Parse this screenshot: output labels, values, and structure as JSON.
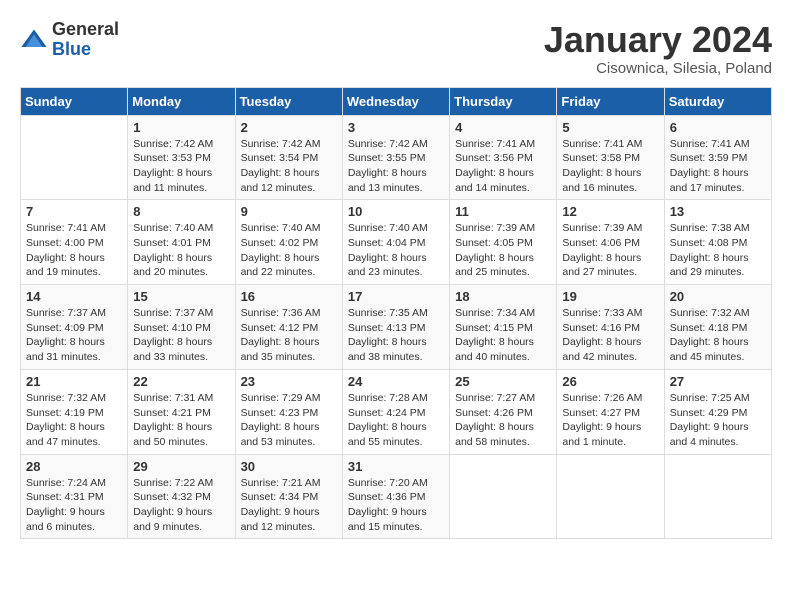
{
  "header": {
    "logo": {
      "general": "General",
      "blue": "Blue"
    },
    "title": "January 2024",
    "location": "Cisownica, Silesia, Poland"
  },
  "days_of_week": [
    "Sunday",
    "Monday",
    "Tuesday",
    "Wednesday",
    "Thursday",
    "Friday",
    "Saturday"
  ],
  "weeks": [
    [
      {
        "day": "",
        "sunrise": "",
        "sunset": "",
        "daylight": ""
      },
      {
        "day": "1",
        "sunrise": "Sunrise: 7:42 AM",
        "sunset": "Sunset: 3:53 PM",
        "daylight": "Daylight: 8 hours and 11 minutes."
      },
      {
        "day": "2",
        "sunrise": "Sunrise: 7:42 AM",
        "sunset": "Sunset: 3:54 PM",
        "daylight": "Daylight: 8 hours and 12 minutes."
      },
      {
        "day": "3",
        "sunrise": "Sunrise: 7:42 AM",
        "sunset": "Sunset: 3:55 PM",
        "daylight": "Daylight: 8 hours and 13 minutes."
      },
      {
        "day": "4",
        "sunrise": "Sunrise: 7:41 AM",
        "sunset": "Sunset: 3:56 PM",
        "daylight": "Daylight: 8 hours and 14 minutes."
      },
      {
        "day": "5",
        "sunrise": "Sunrise: 7:41 AM",
        "sunset": "Sunset: 3:58 PM",
        "daylight": "Daylight: 8 hours and 16 minutes."
      },
      {
        "day": "6",
        "sunrise": "Sunrise: 7:41 AM",
        "sunset": "Sunset: 3:59 PM",
        "daylight": "Daylight: 8 hours and 17 minutes."
      }
    ],
    [
      {
        "day": "7",
        "sunrise": "Sunrise: 7:41 AM",
        "sunset": "Sunset: 4:00 PM",
        "daylight": "Daylight: 8 hours and 19 minutes."
      },
      {
        "day": "8",
        "sunrise": "Sunrise: 7:40 AM",
        "sunset": "Sunset: 4:01 PM",
        "daylight": "Daylight: 8 hours and 20 minutes."
      },
      {
        "day": "9",
        "sunrise": "Sunrise: 7:40 AM",
        "sunset": "Sunset: 4:02 PM",
        "daylight": "Daylight: 8 hours and 22 minutes."
      },
      {
        "day": "10",
        "sunrise": "Sunrise: 7:40 AM",
        "sunset": "Sunset: 4:04 PM",
        "daylight": "Daylight: 8 hours and 23 minutes."
      },
      {
        "day": "11",
        "sunrise": "Sunrise: 7:39 AM",
        "sunset": "Sunset: 4:05 PM",
        "daylight": "Daylight: 8 hours and 25 minutes."
      },
      {
        "day": "12",
        "sunrise": "Sunrise: 7:39 AM",
        "sunset": "Sunset: 4:06 PM",
        "daylight": "Daylight: 8 hours and 27 minutes."
      },
      {
        "day": "13",
        "sunrise": "Sunrise: 7:38 AM",
        "sunset": "Sunset: 4:08 PM",
        "daylight": "Daylight: 8 hours and 29 minutes."
      }
    ],
    [
      {
        "day": "14",
        "sunrise": "Sunrise: 7:37 AM",
        "sunset": "Sunset: 4:09 PM",
        "daylight": "Daylight: 8 hours and 31 minutes."
      },
      {
        "day": "15",
        "sunrise": "Sunrise: 7:37 AM",
        "sunset": "Sunset: 4:10 PM",
        "daylight": "Daylight: 8 hours and 33 minutes."
      },
      {
        "day": "16",
        "sunrise": "Sunrise: 7:36 AM",
        "sunset": "Sunset: 4:12 PM",
        "daylight": "Daylight: 8 hours and 35 minutes."
      },
      {
        "day": "17",
        "sunrise": "Sunrise: 7:35 AM",
        "sunset": "Sunset: 4:13 PM",
        "daylight": "Daylight: 8 hours and 38 minutes."
      },
      {
        "day": "18",
        "sunrise": "Sunrise: 7:34 AM",
        "sunset": "Sunset: 4:15 PM",
        "daylight": "Daylight: 8 hours and 40 minutes."
      },
      {
        "day": "19",
        "sunrise": "Sunrise: 7:33 AM",
        "sunset": "Sunset: 4:16 PM",
        "daylight": "Daylight: 8 hours and 42 minutes."
      },
      {
        "day": "20",
        "sunrise": "Sunrise: 7:32 AM",
        "sunset": "Sunset: 4:18 PM",
        "daylight": "Daylight: 8 hours and 45 minutes."
      }
    ],
    [
      {
        "day": "21",
        "sunrise": "Sunrise: 7:32 AM",
        "sunset": "Sunset: 4:19 PM",
        "daylight": "Daylight: 8 hours and 47 minutes."
      },
      {
        "day": "22",
        "sunrise": "Sunrise: 7:31 AM",
        "sunset": "Sunset: 4:21 PM",
        "daylight": "Daylight: 8 hours and 50 minutes."
      },
      {
        "day": "23",
        "sunrise": "Sunrise: 7:29 AM",
        "sunset": "Sunset: 4:23 PM",
        "daylight": "Daylight: 8 hours and 53 minutes."
      },
      {
        "day": "24",
        "sunrise": "Sunrise: 7:28 AM",
        "sunset": "Sunset: 4:24 PM",
        "daylight": "Daylight: 8 hours and 55 minutes."
      },
      {
        "day": "25",
        "sunrise": "Sunrise: 7:27 AM",
        "sunset": "Sunset: 4:26 PM",
        "daylight": "Daylight: 8 hours and 58 minutes."
      },
      {
        "day": "26",
        "sunrise": "Sunrise: 7:26 AM",
        "sunset": "Sunset: 4:27 PM",
        "daylight": "Daylight: 9 hours and 1 minute."
      },
      {
        "day": "27",
        "sunrise": "Sunrise: 7:25 AM",
        "sunset": "Sunset: 4:29 PM",
        "daylight": "Daylight: 9 hours and 4 minutes."
      }
    ],
    [
      {
        "day": "28",
        "sunrise": "Sunrise: 7:24 AM",
        "sunset": "Sunset: 4:31 PM",
        "daylight": "Daylight: 9 hours and 6 minutes."
      },
      {
        "day": "29",
        "sunrise": "Sunrise: 7:22 AM",
        "sunset": "Sunset: 4:32 PM",
        "daylight": "Daylight: 9 hours and 9 minutes."
      },
      {
        "day": "30",
        "sunrise": "Sunrise: 7:21 AM",
        "sunset": "Sunset: 4:34 PM",
        "daylight": "Daylight: 9 hours and 12 minutes."
      },
      {
        "day": "31",
        "sunrise": "Sunrise: 7:20 AM",
        "sunset": "Sunset: 4:36 PM",
        "daylight": "Daylight: 9 hours and 15 minutes."
      },
      {
        "day": "",
        "sunrise": "",
        "sunset": "",
        "daylight": ""
      },
      {
        "day": "",
        "sunrise": "",
        "sunset": "",
        "daylight": ""
      },
      {
        "day": "",
        "sunrise": "",
        "sunset": "",
        "daylight": ""
      }
    ]
  ]
}
